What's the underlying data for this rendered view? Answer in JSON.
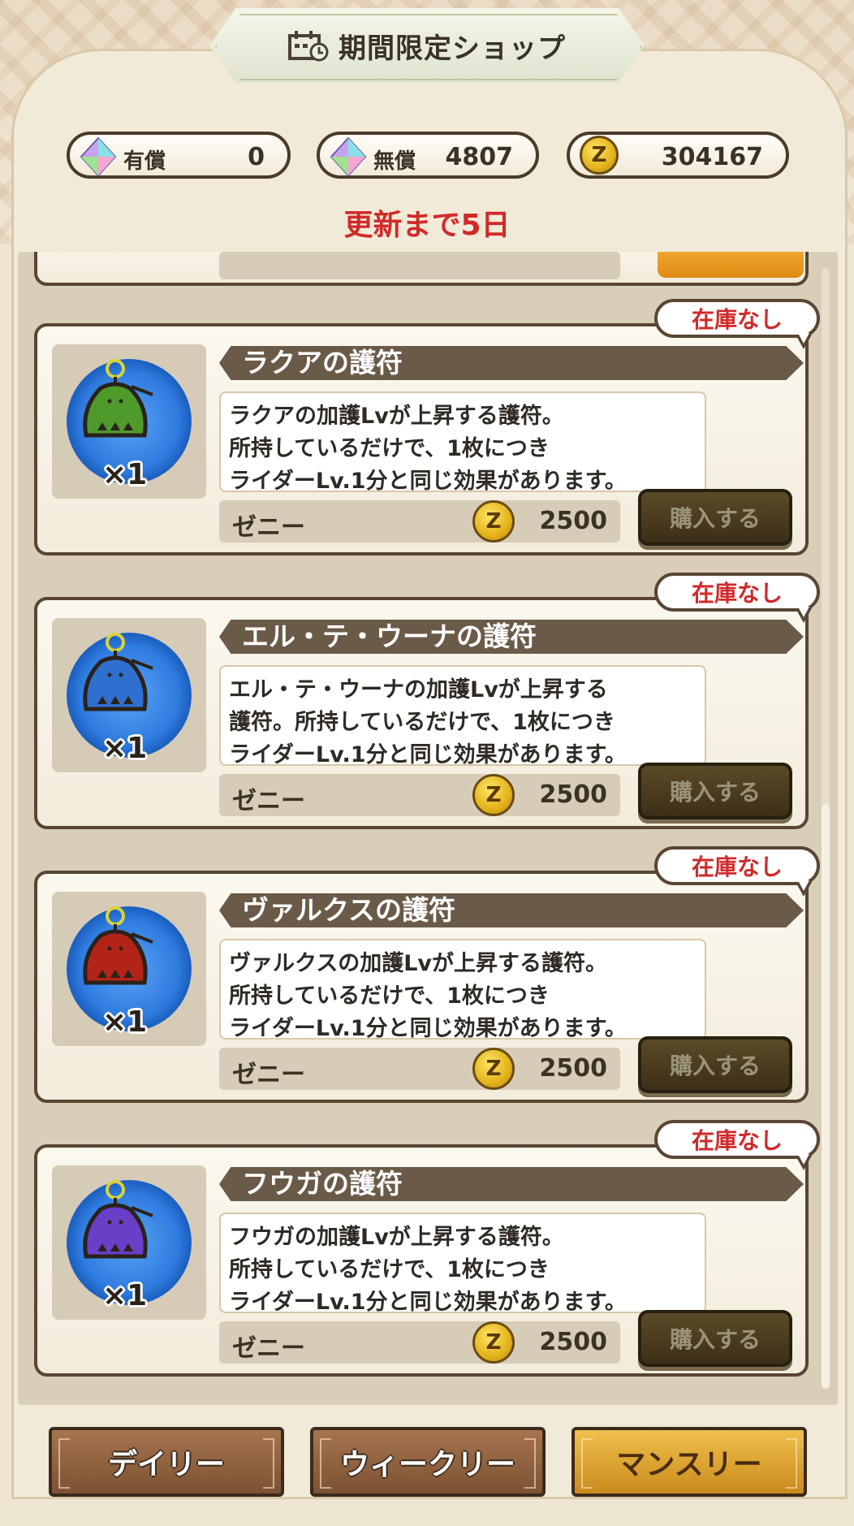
{
  "header": {
    "title": "期間限定ショップ",
    "title_icon": "calendar-clock-icon"
  },
  "currency": {
    "paid": {
      "label": "有償",
      "value": "0",
      "icon": "crystal-gem-icon"
    },
    "free": {
      "label": "無償",
      "value": "4807",
      "icon": "crystal-gem-icon"
    },
    "zenny": {
      "symbol": "Z",
      "value": "304167",
      "icon": "zenny-coin-icon"
    }
  },
  "refresh_notice": "更新まで5日",
  "items": [
    {
      "name": "ラクアの護符",
      "quantity": "×1",
      "desc": [
        "ラクアの加護Lvが上昇する護符。",
        "所持しているだけで、1枚につき",
        "ライダーLv.1分と同じ効果があります。"
      ],
      "currency_label": "ゼニー",
      "coin_symbol": "Z",
      "price": "2500",
      "buy_label": "購入する",
      "stock": "在庫なし",
      "color": "#4e9a2a"
    },
    {
      "name": "エル・テ・ウーナの護符",
      "quantity": "×1",
      "desc": [
        "エル・テ・ウーナの加護Lvが上昇する",
        "護符。所持しているだけで、1枚につき",
        "ライダーLv.1分と同じ効果があります。"
      ],
      "currency_label": "ゼニー",
      "coin_symbol": "Z",
      "price": "2500",
      "buy_label": "購入する",
      "stock": "在庫なし",
      "color": "#2f6fd0"
    },
    {
      "name": "ヴァルクスの護符",
      "quantity": "×1",
      "desc": [
        "ヴァルクスの加護Lvが上昇する護符。",
        "所持しているだけで、1枚につき",
        "ライダーLv.1分と同じ効果があります。"
      ],
      "currency_label": "ゼニー",
      "coin_symbol": "Z",
      "price": "2500",
      "buy_label": "購入する",
      "stock": "在庫なし",
      "color": "#b32418"
    },
    {
      "name": "フウガの護符",
      "quantity": "×1",
      "desc": [
        "フウガの加護Lvが上昇する護符。",
        "所持しているだけで、1枚につき",
        "ライダーLv.1分と同じ効果があります。"
      ],
      "currency_label": "ゼニー",
      "coin_symbol": "Z",
      "price": "2500",
      "buy_label": "購入する",
      "stock": "在庫なし",
      "color": "#6a3fc8"
    }
  ],
  "tabs": [
    {
      "label": "デイリー",
      "active": false
    },
    {
      "label": "ウィークリー",
      "active": false
    },
    {
      "label": "マンスリー",
      "active": true
    }
  ]
}
